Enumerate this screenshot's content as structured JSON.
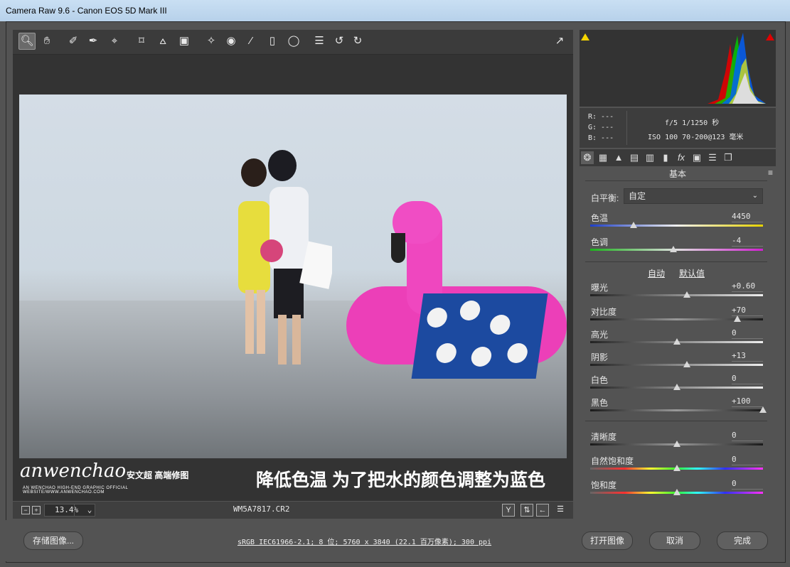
{
  "window": {
    "title": "Camera Raw 9.6  -  Canon EOS 5D Mark III"
  },
  "toolbar": {
    "tools": [
      "zoom-icon",
      "hand-icon",
      "white-balance-icon",
      "color-sampler-icon",
      "targeted-adjustment-icon",
      "crop-icon",
      "straighten-icon",
      "transform-icon",
      "spot-removal-icon",
      "red-eye-icon",
      "adjustment-brush-icon",
      "graduated-filter-icon",
      "radial-filter-icon",
      "preferences-icon",
      "rotate-ccw-icon",
      "rotate-cw-icon"
    ],
    "fullscreen_icon": "fullscreen-icon"
  },
  "preview": {
    "watermark_logo": "anwenchao",
    "watermark_cn": "安文超 高端修图",
    "watermark_sub": "AN WENCHAO HIGH-END GRAPHIC OFFICIAL WEBSITE/WWW.ANWENCHAO.COM",
    "caption": "降低色温 为了把水的颜色调整为蓝色",
    "zoom": "13.4%",
    "filename": "WM5A7817.CR2"
  },
  "info": {
    "r": "R:  ---",
    "g": "G:  ---",
    "b": "B:  ---",
    "exif_line1": "f/5   1/1250 秒",
    "exif_line2": "ISO 100   70-200@123 毫米"
  },
  "panel": {
    "title": "基本",
    "white_balance_label": "白平衡:",
    "white_balance_value": "自定",
    "auto_link": "自动",
    "default_link": "默认值",
    "sliders": [
      {
        "label": "色温",
        "value": "4450",
        "position": 0.25,
        "gradient": "temperature"
      },
      {
        "label": "色调",
        "value": "-4",
        "position": 0.48,
        "gradient": "tint"
      },
      {
        "label": "曝光",
        "value": "+0.60",
        "position": 0.56,
        "gradient": "plain"
      },
      {
        "label": "对比度",
        "value": "+70",
        "position": 0.85,
        "gradient": "dark"
      },
      {
        "label": "高光",
        "value": "0",
        "position": 0.5,
        "gradient": "plain"
      },
      {
        "label": "阴影",
        "value": "+13",
        "position": 0.56,
        "gradient": "plain"
      },
      {
        "label": "白色",
        "value": "0",
        "position": 0.5,
        "gradient": "plain"
      },
      {
        "label": "黑色",
        "value": "+100",
        "position": 1.0,
        "gradient": "dark"
      },
      {
        "label": "清晰度",
        "value": "0",
        "position": 0.5,
        "gradient": "dark"
      },
      {
        "label": "自然饱和度",
        "value": "0",
        "position": 0.5,
        "gradient": "spectrum"
      },
      {
        "label": "饱和度",
        "value": "0",
        "position": 0.5,
        "gradient": "spectrum"
      }
    ]
  },
  "footer": {
    "save_label": "存储图像...",
    "workflow_link": "sRGB IEC61966-2.1; 8 位; 5760 x 3840 (22.1 百万像素); 300 ppi",
    "open_label": "打开图像",
    "cancel_label": "取消",
    "done_label": "完成"
  },
  "colors": {
    "accent_magenta": "#ec3fb8",
    "panel_bg": "#535353",
    "toolbar_bg": "#3b3b3b"
  }
}
